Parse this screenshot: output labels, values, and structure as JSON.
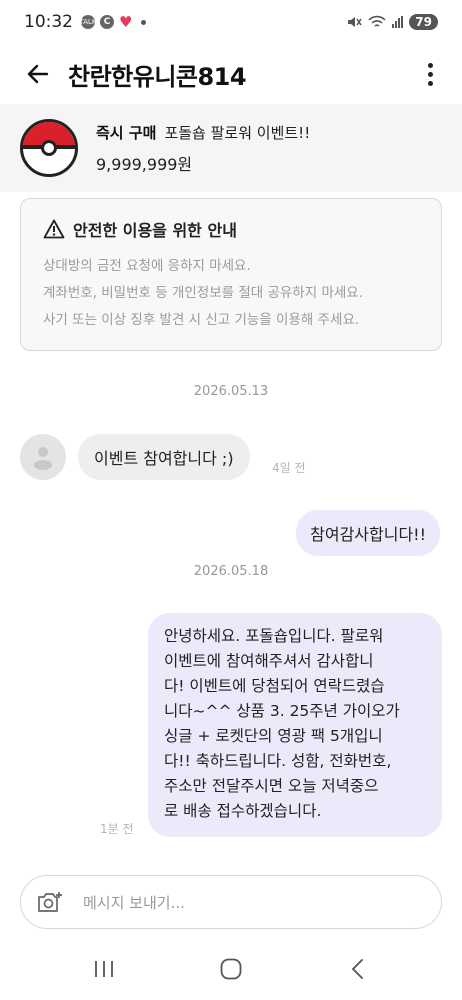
{
  "status_bar": {
    "time": "10:32",
    "battery": "79",
    "icons": [
      "talk-icon",
      "c-icon",
      "heart-icon",
      "dot-icon",
      "mute-icon",
      "wifi-icon",
      "signal-icon",
      "battery-icon"
    ]
  },
  "header": {
    "title": "찬란한유니콘814",
    "back_icon": "arrow-left-icon",
    "menu_icon": "more-vertical-icon"
  },
  "product": {
    "badge": "즉시 구매",
    "name": "포돌숍 팔로워 이벤트!!",
    "price": "9,999,999원",
    "image": "pokeball-icon"
  },
  "safety_notice": {
    "title": "안전한 이용을 위한 안내",
    "lines": [
      "상대방의 금전 요청에 응하지 마세요.",
      "계좌번호, 비밀번호 등 개인정보를 절대 공유하지 마세요.",
      "사기 또는 이상 징후 발견 시 신고 기능을 이용해 주세요."
    ]
  },
  "messages": {
    "date1": "2026.05.13",
    "incoming1": {
      "text": "이벤트 참여합니다 ;)",
      "time": "4일 전"
    },
    "outgoing1": {
      "text": "참여감사합니다!!"
    },
    "date2": "2026.05.18",
    "outgoing2": {
      "lines": [
        "안녕하세요. 포돌숍입니다. 팔로워",
        "이벤트에 참여해주셔서 감사합니",
        "다! 이벤트에 당첨되어 연락드렸습",
        "니다~^^ 상품 3. 25주년 가이오가",
        "싱글 + 로켓단의 영광 팩 5개입니",
        "다!! 축하드립니다. 성함, 전화번호,",
        "주소만 전달주시면 오늘 저녁중으",
        "로 배송 접수하겠습니다."
      ],
      "time": "1분 전"
    }
  },
  "composer": {
    "placeholder": "메시지 보내기...",
    "camera_icon": "camera-plus-icon"
  },
  "nav": {
    "icons": [
      "recent-apps-icon",
      "home-icon",
      "back-icon"
    ]
  },
  "colors": {
    "outgoing_bubble": "#ece9fb",
    "incoming_bubble": "#eeeeee",
    "product_bar": "#f5f5f5",
    "pokeball_red": "#d9202b"
  }
}
